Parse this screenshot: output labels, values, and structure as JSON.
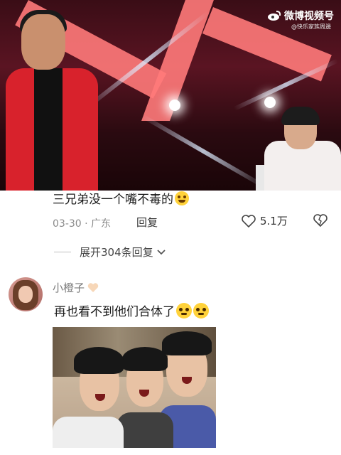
{
  "video": {
    "watermark_text": "微博视频号",
    "watermark_sub": "@快乐家族周邊",
    "accent_colors": {
      "stage_red": "#d8222c",
      "beam": "#dfe9ff"
    }
  },
  "comment1": {
    "text": "三兄弟没一个嘴不毒的",
    "emoji": "sweat-smile-emoji",
    "date": "03-30",
    "location": "广东",
    "reply_label": "回复",
    "likes": "5.1万"
  },
  "expand": {
    "label": "展开304条回复"
  },
  "comment2": {
    "username": "小橙子",
    "text": "再也看不到他们合体了",
    "emojis": [
      "crying-emoji",
      "pleading-emoji"
    ]
  }
}
